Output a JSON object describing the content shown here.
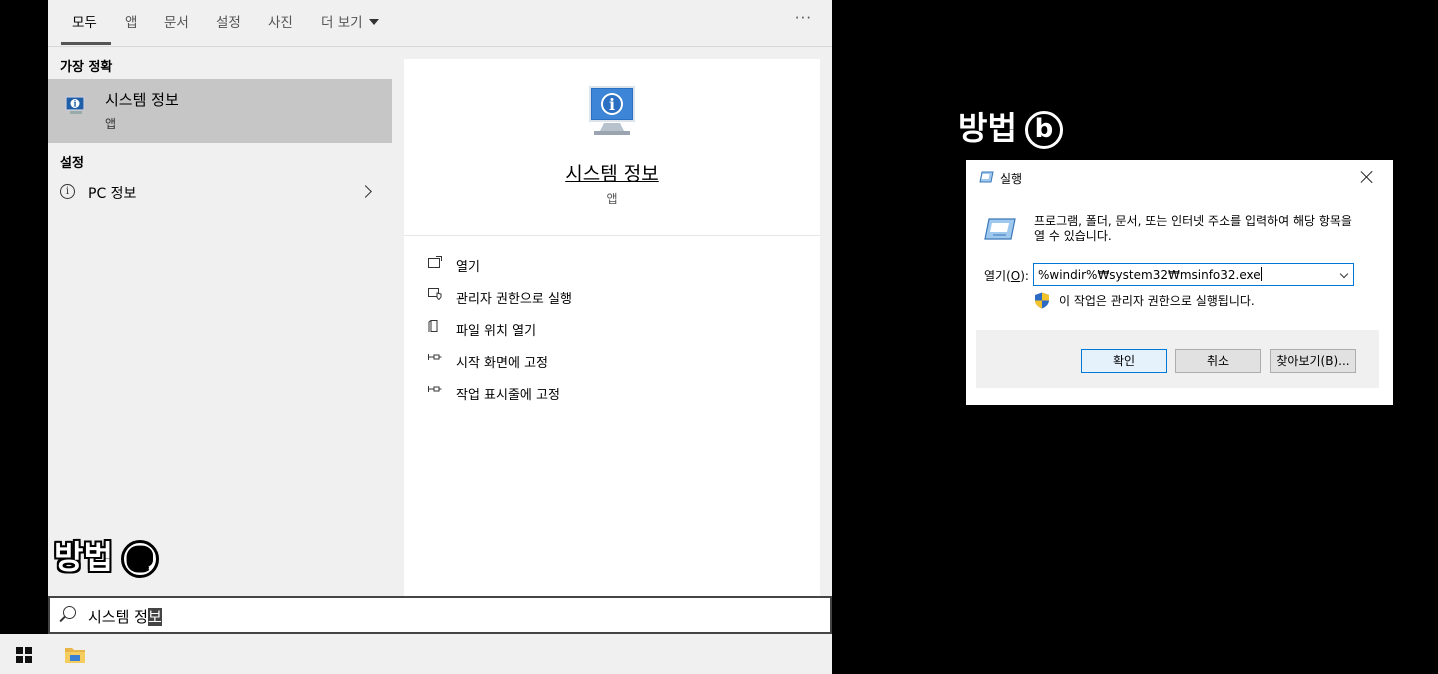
{
  "search": {
    "tabs": [
      {
        "label": "모두"
      },
      {
        "label": "앱"
      },
      {
        "label": "문서"
      },
      {
        "label": "설정"
      },
      {
        "label": "사진"
      },
      {
        "label": "더 보기"
      }
    ],
    "more_icon": "ellipsis-icon",
    "best_match_header": "가장 정확",
    "best_match": {
      "name": "시스템 정보",
      "type": "앱",
      "icon": "system-info-icon"
    },
    "settings_header": "설정",
    "settings_item": {
      "label": "PC 정보",
      "icon": "info-icon"
    },
    "detail": {
      "title": "시스템 정보",
      "type": "앱",
      "actions": [
        {
          "label": "열기",
          "icon": "open-icon"
        },
        {
          "label": "관리자 권한으로 실행",
          "icon": "shield-run-icon"
        },
        {
          "label": "파일 위치 열기",
          "icon": "file-location-icon"
        },
        {
          "label": "시작 화면에 고정",
          "icon": "pin-icon"
        },
        {
          "label": "작업 표시줄에 고정",
          "icon": "pin-icon"
        }
      ]
    },
    "query_prefix": "시스템 정",
    "query_selected": "보"
  },
  "watermarks": {
    "a_text": "방법",
    "a_badge": "@",
    "b_text": "방법",
    "b_badge": "b"
  },
  "run_dialog": {
    "title": "실행",
    "description": "프로그램, 폴더, 문서, 또는 인터넷 주소를 입력하여 해당 항목을 열 수 있습니다.",
    "open_label_prefix": "열기(",
    "open_label_key": "O",
    "open_label_suffix": "):",
    "command_value": "%windir%₩system32₩msinfo32.exe",
    "admin_note": "이 작업은 관리자 권한으로 실행됩니다.",
    "buttons": {
      "ok": "확인",
      "cancel": "취소",
      "browse": "찾아보기(B)..."
    }
  },
  "colors": {
    "accent": "#0078d7",
    "panel_bg": "#f0f0f0",
    "selected_bg": "#c6c6c6"
  }
}
